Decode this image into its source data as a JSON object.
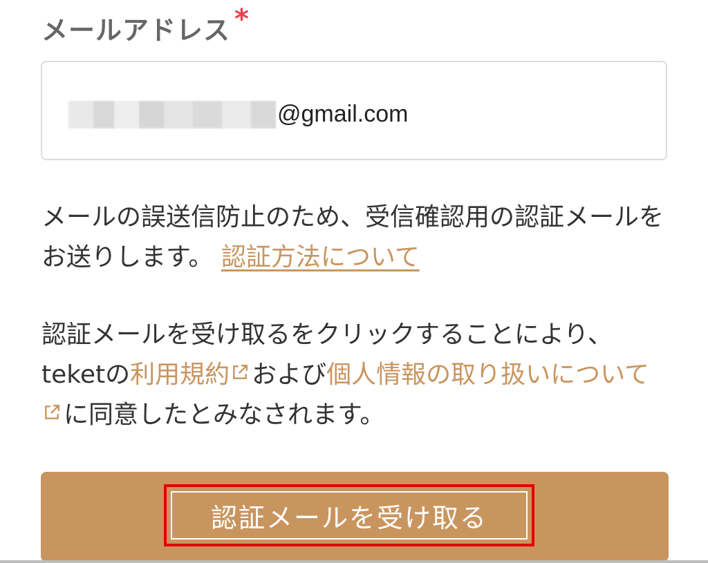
{
  "email_field": {
    "label": "メールアドレス",
    "required_mark": "*",
    "value_visible": "@gmail.com"
  },
  "notice": {
    "text": "メールの誤送信防止のため、受信確認用の認証メールをお送りします。",
    "link_label": "認証方法について"
  },
  "consent": {
    "prefix": "認証メールを受け取るをクリックすることにより、teketの",
    "terms_link": "利用規約",
    "middle": "および",
    "privacy_link": "個人情報の取り扱いについて",
    "suffix": "に同意したとみなされます。"
  },
  "submit_button": {
    "label": "認証メールを受け取る"
  },
  "icons": {
    "external_link": "external-link-icon"
  },
  "colors": {
    "accent": "#c9955f",
    "required": "#e8424f",
    "highlight_border": "#e30000"
  }
}
